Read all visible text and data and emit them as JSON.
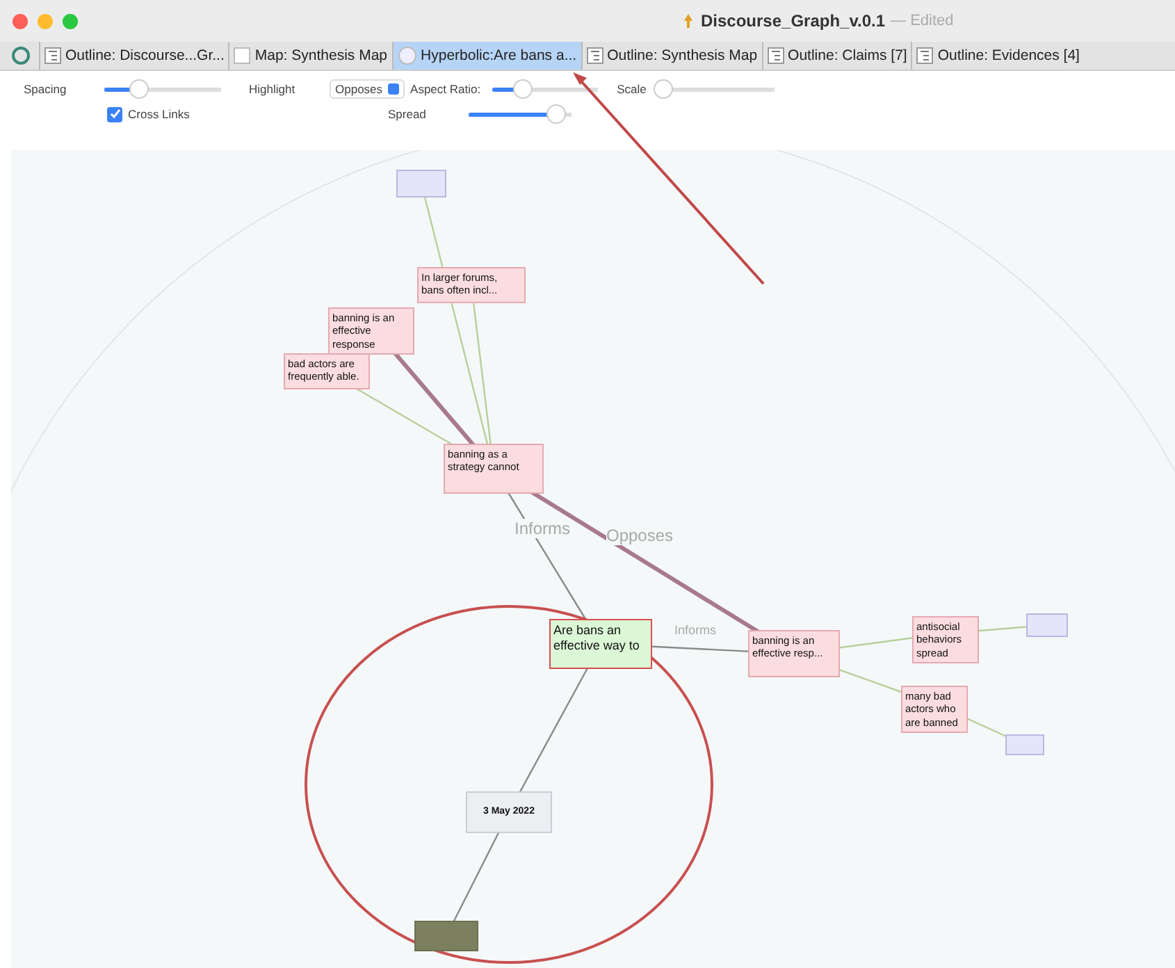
{
  "window": {
    "title": "Discourse_Graph_v.0.1",
    "status": "— Edited"
  },
  "tabs": [
    {
      "label": "Outline: Discourse...Gr...",
      "kind": "outline",
      "selected": false
    },
    {
      "label": "Map: Synthesis Map",
      "kind": "map",
      "selected": false
    },
    {
      "label": "Hyperbolic:Are bans a...",
      "kind": "hyperbolic",
      "selected": true
    },
    {
      "label": "Outline: Synthesis Map",
      "kind": "outline",
      "selected": false
    },
    {
      "label": "Outline: Claims [7]",
      "kind": "outline",
      "selected": false
    },
    {
      "label": "Outline: Evidences [4]",
      "kind": "outline",
      "selected": false
    }
  ],
  "controls": {
    "spacing": {
      "label": "Spacing",
      "level": 0.3
    },
    "highlight": {
      "label": "Highlight",
      "value": "Opposes"
    },
    "aspect_ratio": {
      "label": "Aspect Ratio:",
      "level": 0.3
    },
    "scale": {
      "label": "Scale",
      "level": 0.05
    },
    "cross_links": {
      "label": "Cross Links",
      "checked": true
    },
    "spread": {
      "label": "Spread",
      "level": 0.85
    }
  },
  "graph": {
    "nodes": [
      {
        "kind": "evidence"
      },
      {
        "kind": "claim",
        "text": "In larger forums, bans often incl..."
      },
      {
        "kind": "claim",
        "text": "banning is an effective response"
      },
      {
        "kind": "claim",
        "text": "bad actors are frequently able."
      },
      {
        "kind": "claim",
        "text": "banning as a strategy cannot"
      },
      {
        "kind": "question",
        "text": "Are bans an effective way to"
      },
      {
        "kind": "claim",
        "text": "banning is an effective resp..."
      },
      {
        "kind": "claim",
        "text": "antisocial behaviors spread"
      },
      {
        "kind": "claim",
        "text": "many bad actors who are banned"
      },
      {
        "kind": "evidence"
      },
      {
        "kind": "evidence"
      },
      {
        "kind": "date",
        "text": "3 May 2022"
      },
      {
        "kind": "source"
      }
    ],
    "edge_labels": [
      "Informs",
      "Opposes",
      "Informs"
    ]
  }
}
